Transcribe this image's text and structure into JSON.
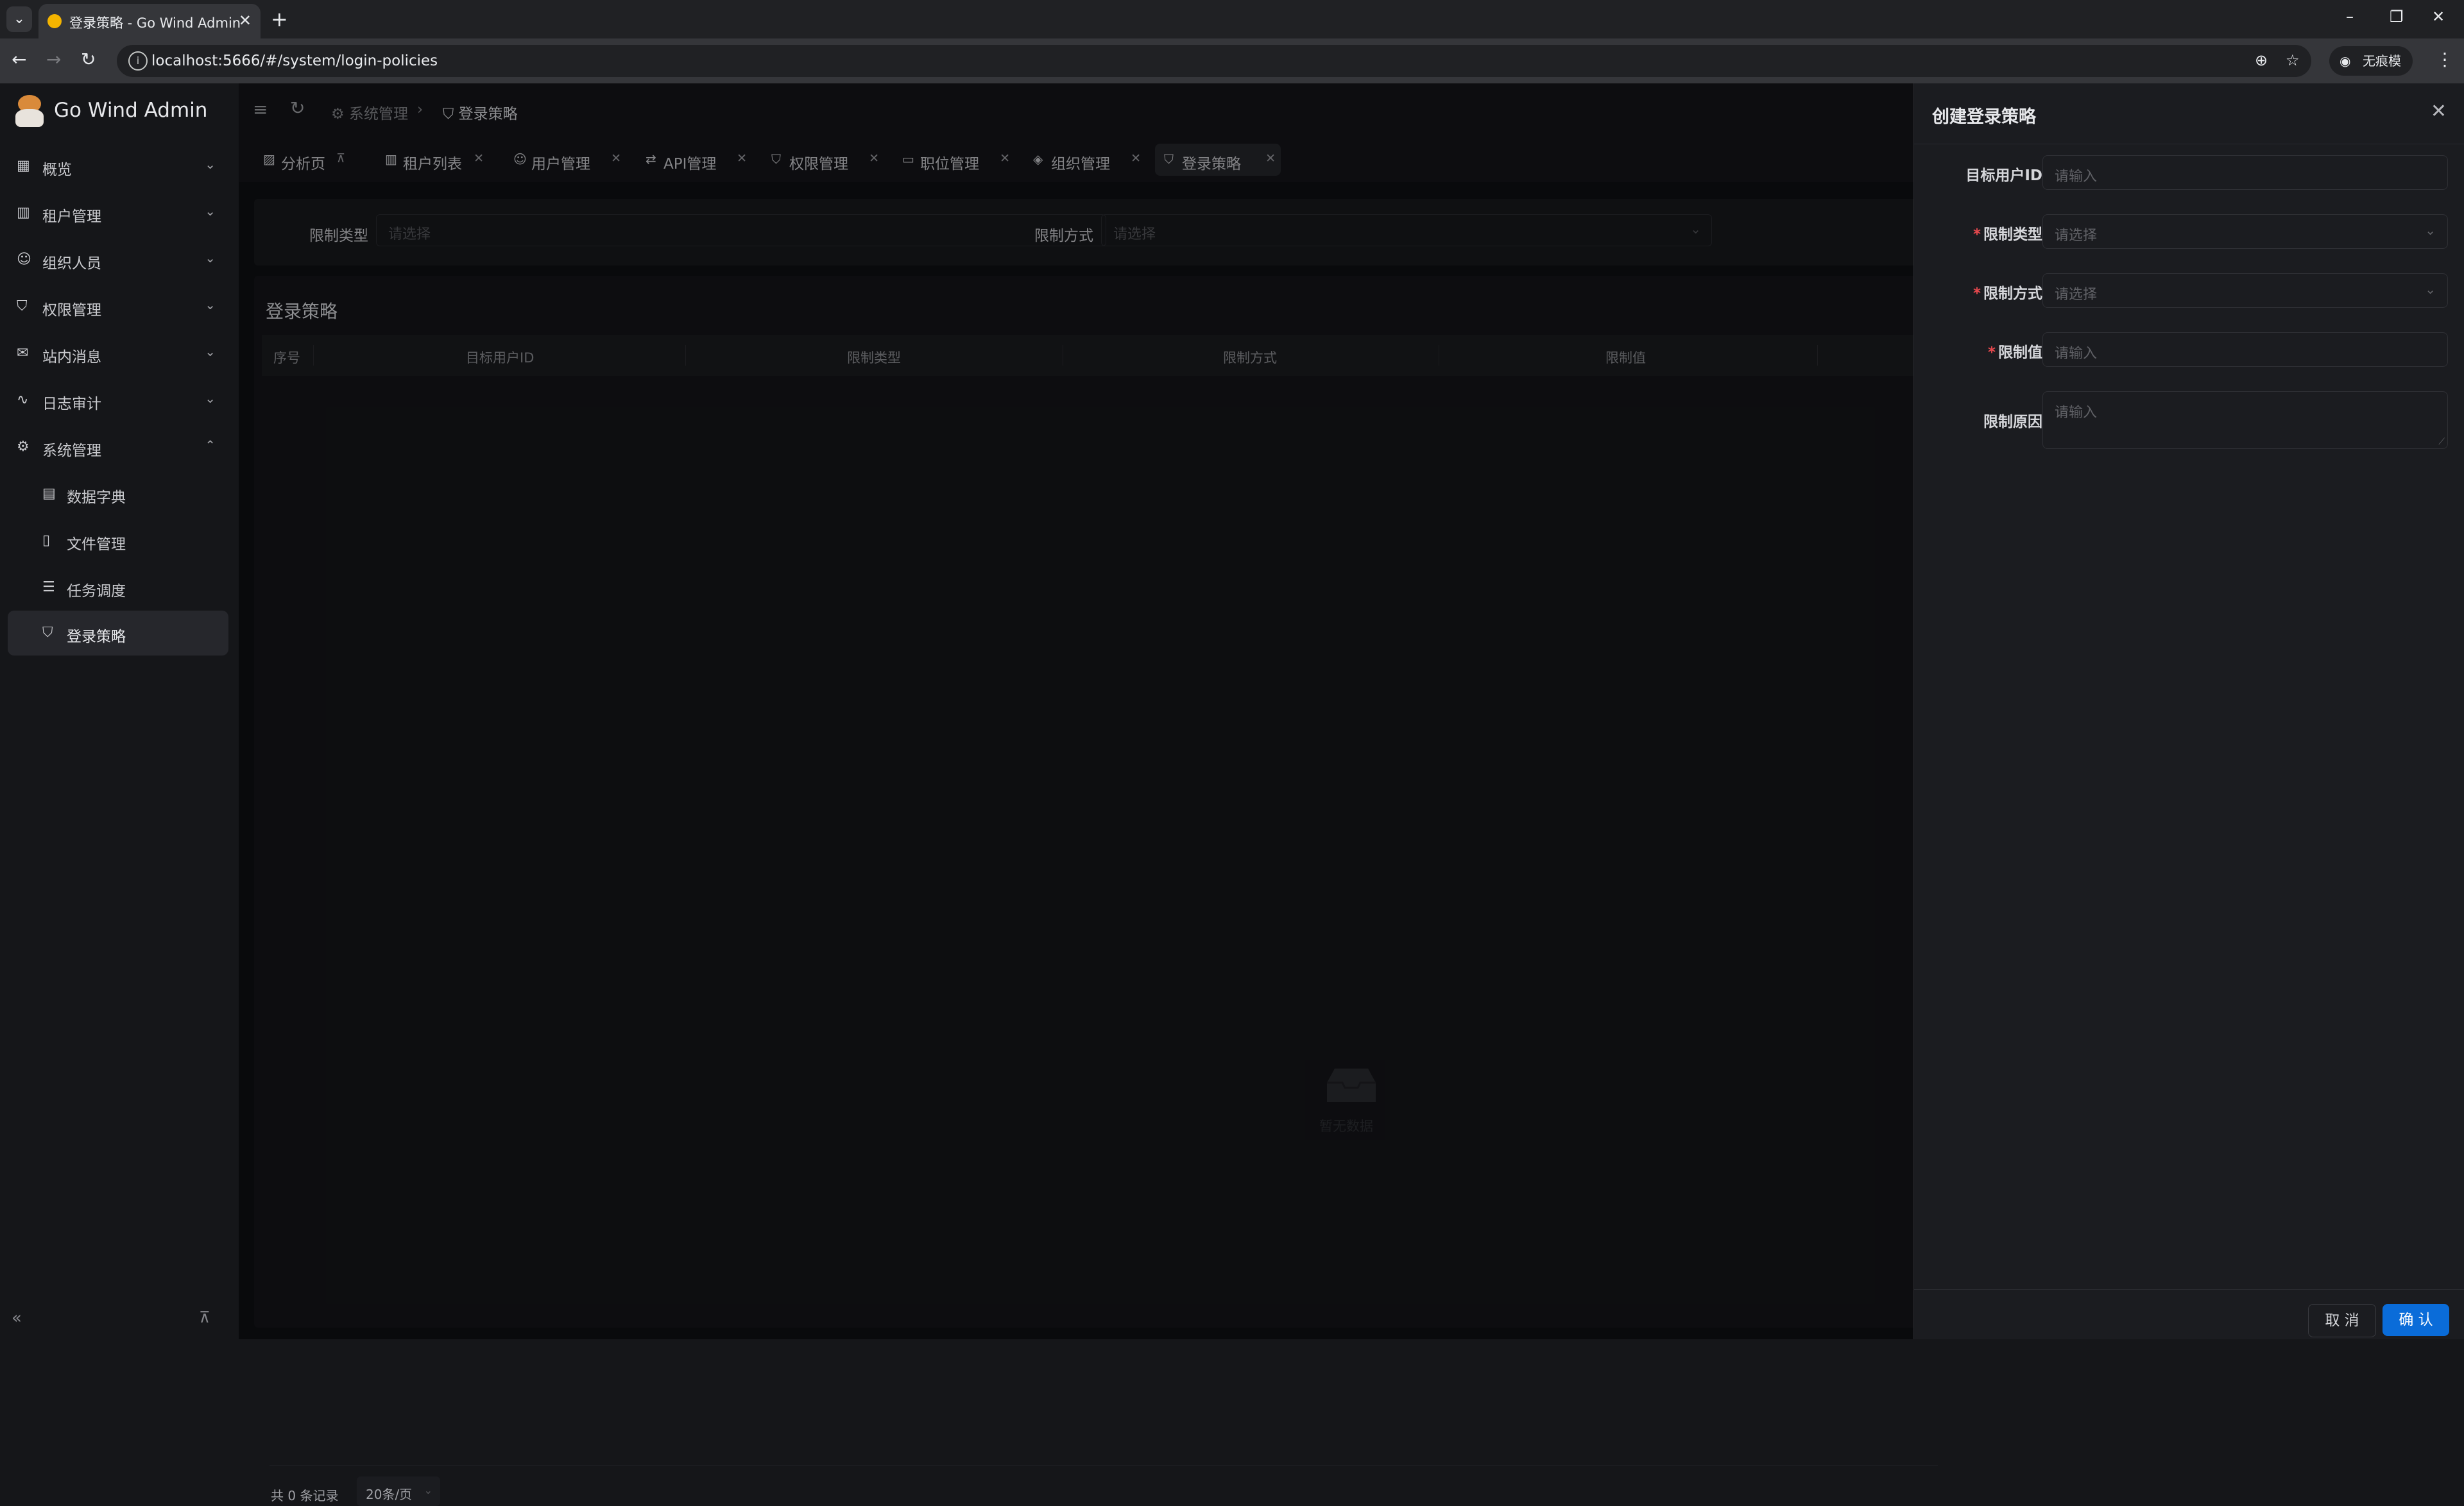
{
  "browser": {
    "tab_title": "登录策略 - Go Wind Admin",
    "url": "localhost:5666/#/system/login-policies",
    "incognito_label": "无痕模式"
  },
  "app": {
    "title": "Go Wind Admin"
  },
  "sidebar": {
    "items": [
      {
        "label": "概览",
        "icon": "dashboard-icon"
      },
      {
        "label": "租户管理",
        "icon": "building-icon"
      },
      {
        "label": "组织人员",
        "icon": "users-icon"
      },
      {
        "label": "权限管理",
        "icon": "shield-icon"
      },
      {
        "label": "站内消息",
        "icon": "mail-icon"
      },
      {
        "label": "日志审计",
        "icon": "activity-icon"
      },
      {
        "label": "系统管理",
        "icon": "gear-icon"
      }
    ],
    "sub_items": [
      {
        "label": "数据字典",
        "icon": "book-icon"
      },
      {
        "label": "文件管理",
        "icon": "file-icon"
      },
      {
        "label": "任务调度",
        "icon": "list-icon"
      },
      {
        "label": "登录策略",
        "icon": "shield-check-icon"
      }
    ]
  },
  "breadcrumb": {
    "parent": "系统管理",
    "current": "登录策略"
  },
  "page_tabs": [
    {
      "label": "分析页",
      "icon": "chart-icon"
    },
    {
      "label": "租户列表",
      "icon": "building-icon"
    },
    {
      "label": "用户管理",
      "icon": "user-icon"
    },
    {
      "label": "API管理",
      "icon": "api-icon"
    },
    {
      "label": "权限管理",
      "icon": "shield-icon"
    },
    {
      "label": "职位管理",
      "icon": "briefcase-icon"
    },
    {
      "label": "组织管理",
      "icon": "layers-icon"
    },
    {
      "label": "登录策略",
      "icon": "shield-check-icon"
    }
  ],
  "filter": {
    "type_label": "限制类型",
    "type_placeholder": "请选择",
    "method_label": "限制方式",
    "method_placeholder": "请选择"
  },
  "table": {
    "title": "登录策略",
    "columns": [
      "序号",
      "目标用户ID",
      "限制类型",
      "限制方式",
      "限制值"
    ],
    "empty_text": "暂无数据",
    "total": "共 0 条记录",
    "page_size": "20条/页"
  },
  "drawer": {
    "title": "创建登录策略",
    "fields": {
      "target_user_id": {
        "label": "目标用户ID",
        "placeholder": "请输入"
      },
      "limit_type": {
        "label": "限制类型",
        "placeholder": "请选择"
      },
      "limit_method": {
        "label": "限制方式",
        "placeholder": "请选择"
      },
      "limit_value": {
        "label": "限制值",
        "placeholder": "请输入"
      },
      "limit_reason": {
        "label": "限制原因",
        "placeholder": "请输入"
      }
    },
    "cancel_label": "取 消",
    "ok_label": "确 认"
  },
  "colors": {
    "primary": "#0a6cd9",
    "required": "#e5484d",
    "background": "#151619"
  }
}
